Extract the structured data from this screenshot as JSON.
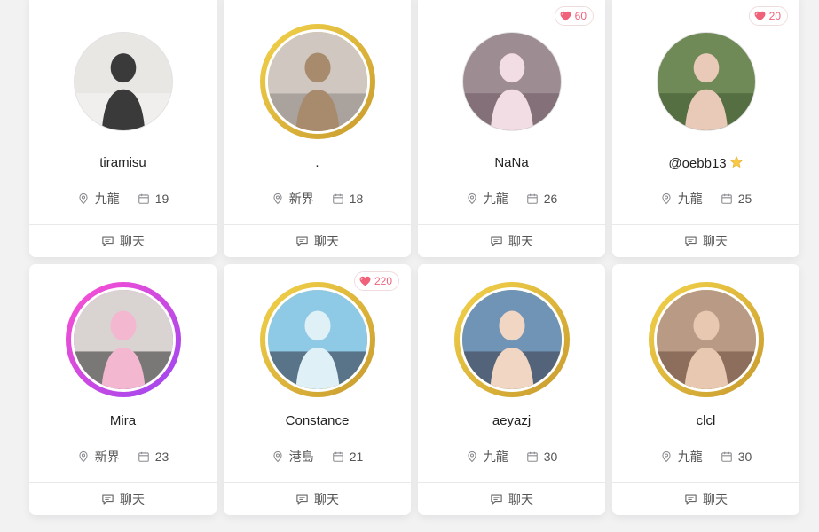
{
  "cards": [
    {
      "name": "tiramisu",
      "location": "九龍",
      "age": "19",
      "chat": "聊天",
      "likes": null,
      "ring": "none",
      "verified": false,
      "photo": {
        "bg": "#e9e7e4",
        "fg": "#3a3a3a",
        "accent": "#f5f5f5"
      }
    },
    {
      "name": ".",
      "location": "新界",
      "age": "18",
      "chat": "聊天",
      "likes": null,
      "ring": "gold",
      "verified": false,
      "photo": {
        "bg": "#cfc7c0",
        "fg": "#a88a6c",
        "accent": "#8a8480"
      }
    },
    {
      "name": "NaNa",
      "location": "九龍",
      "age": "26",
      "chat": "聊天",
      "likes": "60",
      "ring": "none",
      "verified": false,
      "photo": {
        "bg": "#9e8c93",
        "fg": "#f3dde5",
        "accent": "#6d5a63"
      }
    },
    {
      "name": "@oebb13",
      "location": "九龍",
      "age": "25",
      "chat": "聊天",
      "likes": "20",
      "ring": "none",
      "verified": true,
      "photo": {
        "bg": "#6f8a56",
        "fg": "#e9c9b8",
        "accent": "#3f5a34"
      }
    },
    {
      "name": "Mira",
      "location": "新界",
      "age": "23",
      "chat": "聊天",
      "likes": null,
      "ring": "pink",
      "verified": false,
      "photo": {
        "bg": "#d9d4d1",
        "fg": "#f3b8d0",
        "accent": "#2b2b2b"
      }
    },
    {
      "name": "Constance",
      "location": "港島",
      "age": "21",
      "chat": "聊天",
      "likes": "220",
      "ring": "gold",
      "verified": false,
      "photo": {
        "bg": "#8ec9e6",
        "fg": "#dff0f7",
        "accent": "#2d2d3a"
      }
    },
    {
      "name": "aeyazj",
      "location": "九龍",
      "age": "30",
      "chat": "聊天",
      "likes": null,
      "ring": "gold",
      "verified": false,
      "photo": {
        "bg": "#6f94b6",
        "fg": "#f2d6c4",
        "accent": "#3c3c48"
      }
    },
    {
      "name": "clcl",
      "location": "九龍",
      "age": "30",
      "chat": "聊天",
      "likes": null,
      "ring": "gold",
      "verified": false,
      "photo": {
        "bg": "#b89a85",
        "fg": "#e8c8b0",
        "accent": "#6a4a3a"
      }
    }
  ],
  "colors": {
    "gold_ring_a": "#f3d34a",
    "gold_ring_b": "#c89a2e",
    "pink_ring_a": "#ff4fd1",
    "pink_ring_b": "#9b46f0",
    "like_red": "#f0627a"
  },
  "icons": {
    "location": "location-pin-icon",
    "calendar": "calendar-icon",
    "chat": "chat-bubble-icon",
    "heart": "heart-icon",
    "verified": "star-badge-icon"
  }
}
